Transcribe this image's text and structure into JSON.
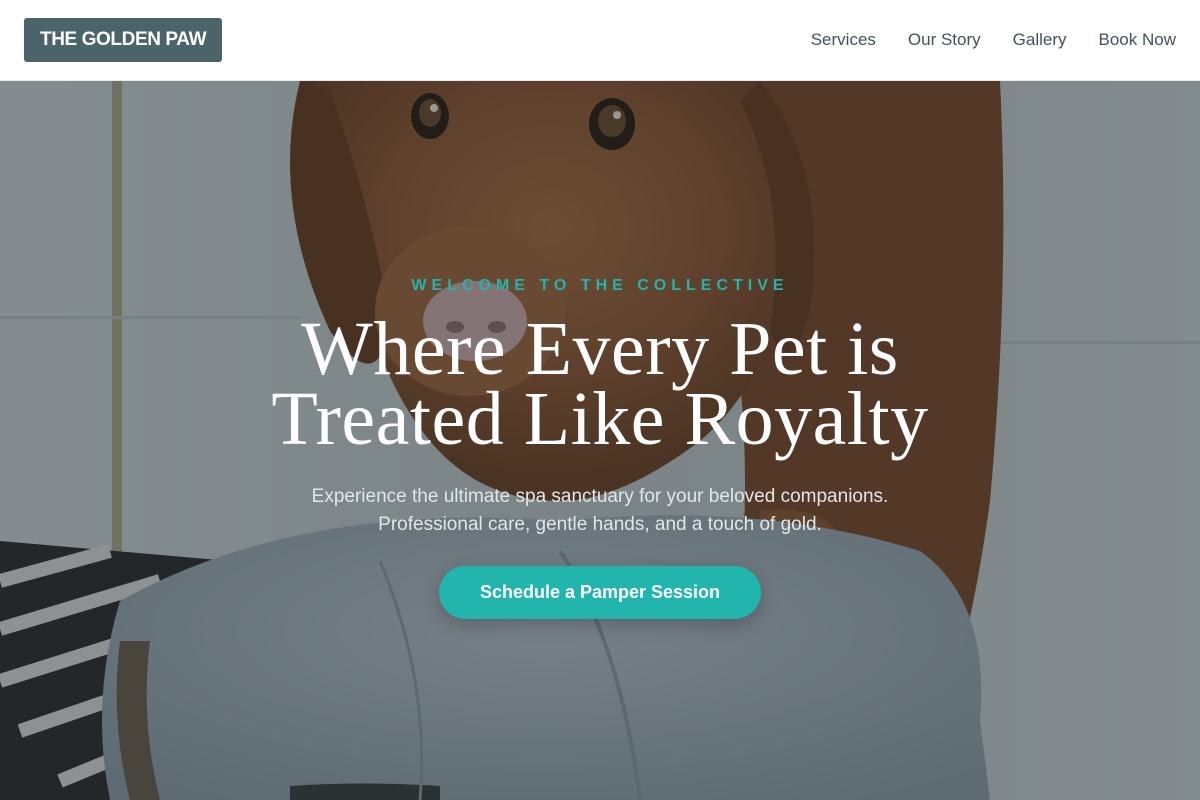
{
  "header": {
    "logo": "THE GOLDEN PAW",
    "nav": [
      {
        "label": "Services"
      },
      {
        "label": "Our Story"
      },
      {
        "label": "Gallery"
      },
      {
        "label": "Book Now"
      }
    ]
  },
  "hero": {
    "eyebrow": "WELCOME TO THE COLLECTIVE",
    "headline": [
      "Where Every Pet is",
      "Treated Like Royalty"
    ],
    "subtext": [
      "Experience the ultimate spa sanctuary for your beloved companions.",
      "Professional care, gentle hands, and a touch of gold."
    ],
    "cta_label": "Schedule a Pamper Session",
    "image": "wet-dog-in-towel-photo"
  },
  "colors": {
    "brand": "#4b6469",
    "accent": "#21b5ad",
    "nav_text": "#3f5459"
  }
}
